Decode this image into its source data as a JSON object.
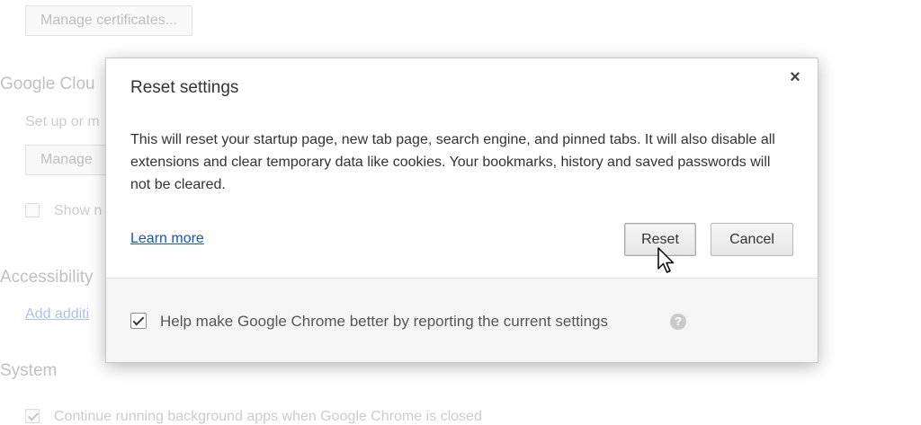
{
  "background": {
    "manage_certificates": "Manage certificates...",
    "google_cloud_heading": "Google Clou",
    "setup_text": "Set up or m",
    "manage_btn": "Manage",
    "show_label": "Show n",
    "accessibility_heading": "Accessibility",
    "add_link": "Add additi",
    "system_heading": "System",
    "continue_label": "Continue running background apps when Google Chrome is closed"
  },
  "dialog": {
    "title": "Reset settings",
    "close_glyph": "×",
    "body": "This will reset your startup page, new tab page, search engine, and pinned tabs. It will also disable all extensions and clear temporary data like cookies. Your bookmarks, history and saved passwords will not be cleared.",
    "learn_more": "Learn more",
    "reset_label": "Reset",
    "cancel_label": "Cancel",
    "footer_checkbox_label": "Help make Google Chrome better by reporting the current settings",
    "footer_checkbox_checked": true,
    "help_glyph": "?"
  },
  "colors": {
    "link": "#1155cc",
    "footer_bg": "#f5f5f5"
  }
}
